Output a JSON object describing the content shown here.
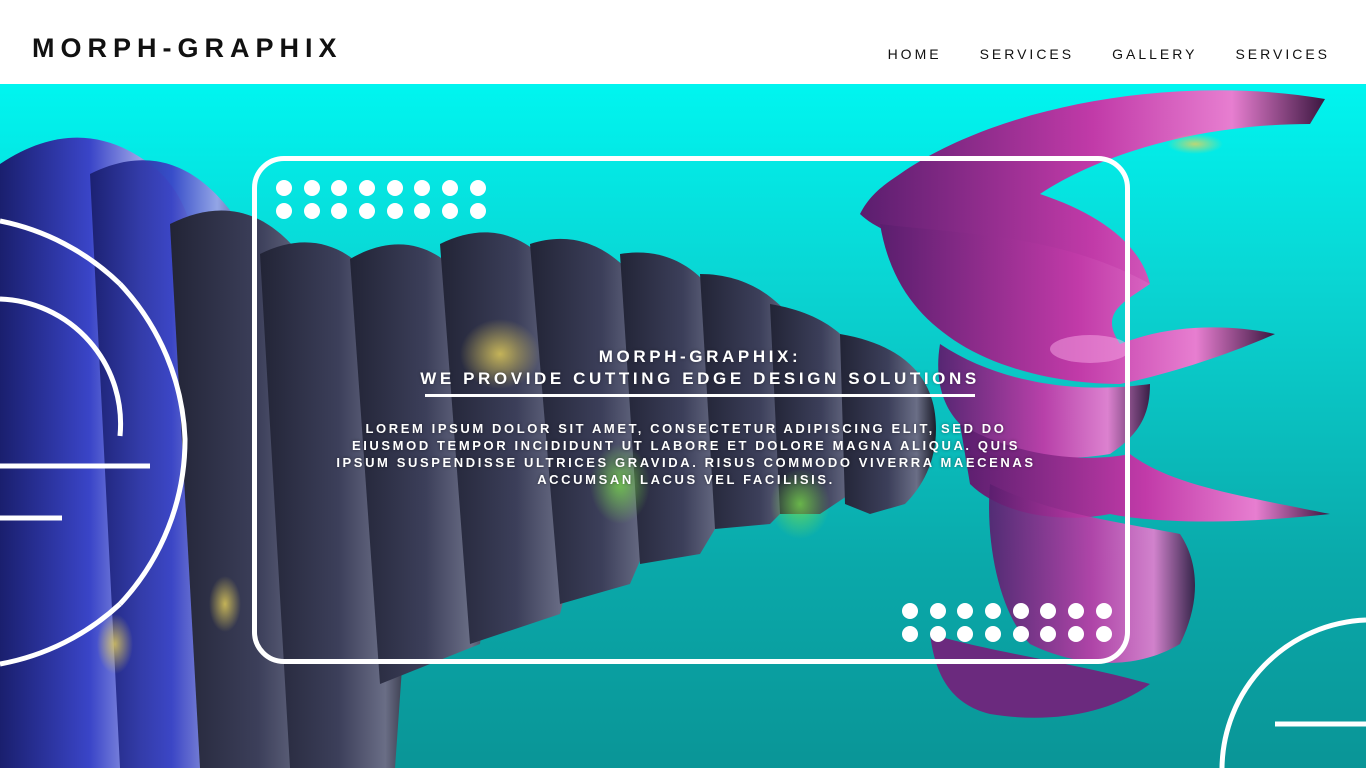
{
  "header": {
    "logo": "MORPH-GRAPHIX",
    "nav": [
      {
        "label": "HOME"
      },
      {
        "label": "SERVICES"
      },
      {
        "label": "GALLERY"
      },
      {
        "label": "SERVICES"
      }
    ]
  },
  "hero": {
    "title_line1": "MORPH-GRAPHIX:",
    "title_line2": "WE PROVIDE CUTTING EDGE DESIGN SOLUTIONS",
    "body": "LOREM IPSUM DOLOR SIT AMET, CONSECTETUR ADIPISCING ELIT, SED DO EIUSMOD TEMPOR INCIDIDUNT UT LABORE ET DOLORE MAGNA ALIQUA. QUIS IPSUM SUSPENDISSE ULTRICES GRAVIDA. RISUS COMMODO VIVERRA MAECENAS ACCUMSAN LACUS VEL FACILISIS."
  },
  "colors": {
    "background_top": "#00f5f0",
    "background_bottom": "#0a9597",
    "accent_purple": "#b0248a",
    "accent_blue": "#2a2f9a",
    "text": "#111111"
  }
}
